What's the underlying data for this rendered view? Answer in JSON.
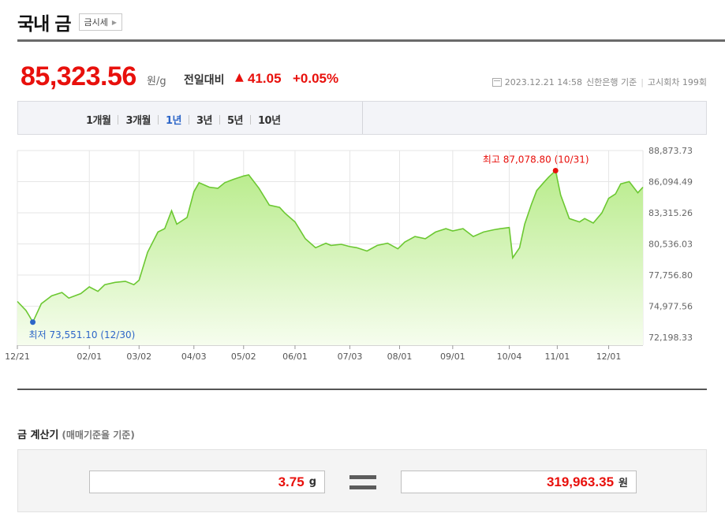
{
  "header": {
    "title": "국내 금",
    "sub_link": "금시세"
  },
  "price": {
    "value": "85,323.56",
    "unit": "원/g",
    "change_label": "전일대비",
    "change_arrow": "▲",
    "change_amount": "41.05",
    "change_pct": "+0.05%",
    "date": "2023.12.21 14:58",
    "source": "신한은행 기준",
    "notice": "고시회차 199회"
  },
  "periods": [
    {
      "label": "1개월",
      "active": false
    },
    {
      "label": "3개월",
      "active": false
    },
    {
      "label": "1년",
      "active": true
    },
    {
      "label": "3년",
      "active": false
    },
    {
      "label": "5년",
      "active": false
    },
    {
      "label": "10년",
      "active": false
    }
  ],
  "chart_data": {
    "type": "area",
    "y_ticks": [
      "88,873.73",
      "86,094.49",
      "83,315.26",
      "80,536.03",
      "77,756.80",
      "74,977.56",
      "72,198.33"
    ],
    "ylim": [
      72198.33,
      88873.73
    ],
    "x_ticks": [
      "12/21",
      "02/01",
      "03/02",
      "04/03",
      "05/02",
      "06/01",
      "07/03",
      "08/01",
      "09/01",
      "10/04",
      "11/01",
      "12/01"
    ],
    "grid": true,
    "color": "#6cc832",
    "max_label": "최고  87,078.80 (10/31)",
    "min_label": "최저  73,551.10 (12/30)",
    "max_color": "#e8100c",
    "min_color": "#2d66c8",
    "max_point": {
      "x": "10/31",
      "y": 87078.8
    },
    "min_point": {
      "x": "12/30",
      "y": 73551.1
    },
    "series": [
      {
        "x": [
          "12/21",
          "12/26",
          "12/28",
          "12/30",
          "01/04",
          "01/10",
          "01/16",
          "01/20",
          "01/27",
          "02/01",
          "02/06",
          "02/10",
          "02/16",
          "02/22",
          "02/27",
          "03/02",
          "03/07",
          "03/13",
          "03/17",
          "03/21",
          "03/24",
          "03/30",
          "04/03",
          "04/06",
          "04/12",
          "04/17",
          "04/21",
          "04/26",
          "05/02",
          "05/05",
          "05/11",
          "05/17",
          "05/23",
          "05/26",
          "06/01",
          "06/07",
          "06/13",
          "06/19",
          "06/22",
          "06/28",
          "07/03",
          "07/07",
          "07/13",
          "07/19",
          "07/25",
          "07/31",
          "08/04",
          "08/10",
          "08/16",
          "08/22",
          "08/28",
          "09/01",
          "09/07",
          "09/13",
          "09/19",
          "09/25",
          "09/29",
          "10/04",
          "10/06",
          "10/10",
          "10/13",
          "10/17",
          "10/20",
          "10/24",
          "10/27",
          "10/31",
          "11/03",
          "11/08",
          "11/14",
          "11/17",
          "11/22",
          "11/27",
          "12/01",
          "12/05",
          "12/08",
          "12/13",
          "12/18",
          "12/21"
        ],
        "values": [
          75400,
          74600,
          74100,
          73551,
          75200,
          75900,
          76200,
          75700,
          76100,
          76700,
          76300,
          76900,
          77100,
          77200,
          76900,
          77300,
          79800,
          81600,
          81900,
          83500,
          82300,
          82900,
          85200,
          86000,
          85600,
          85500,
          86000,
          86300,
          86600,
          86700,
          85500,
          84000,
          83800,
          83300,
          82500,
          81000,
          80200,
          80600,
          80400,
          80500,
          80300,
          80200,
          79900,
          80400,
          80600,
          80100,
          80700,
          81200,
          81000,
          81600,
          81900,
          81700,
          81900,
          81200,
          81600,
          81800,
          81900,
          82000,
          79300,
          80200,
          82300,
          84100,
          85300,
          86000,
          86500,
          87078,
          84900,
          82800,
          82500,
          82800,
          82400,
          83300,
          84600,
          85000,
          85900,
          86100,
          85100,
          85600
        ]
      }
    ]
  },
  "calculator": {
    "title": "금 계산기",
    "subtitle": "(매매기준율 기준)",
    "grams_value": "3.75",
    "grams_unit": "g",
    "won_value": "319,963.35",
    "won_unit": "원"
  }
}
